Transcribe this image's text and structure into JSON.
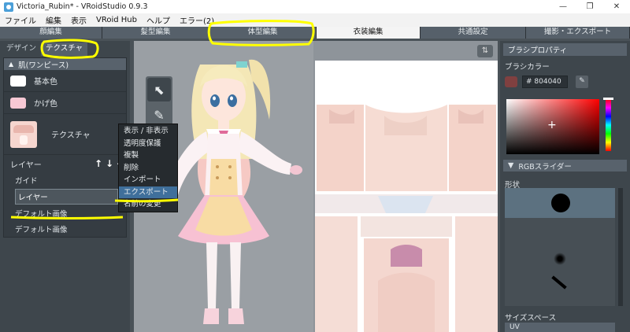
{
  "window": {
    "title": "Victoria_Rubin* - VRoidStudio 0.9.3",
    "minimize": "—",
    "maximize": "❐",
    "close": "✕"
  },
  "menubar": [
    "ファイル",
    "編集",
    "表示",
    "VRoid Hub",
    "ヘルプ",
    "エラー(2)"
  ],
  "tabs": [
    "顔編集",
    "髪型編集",
    "体型編集",
    "衣装編集",
    "共通設定",
    "撮影・エクスポート"
  ],
  "active_tab": "衣装編集",
  "left": {
    "subtabs": [
      "デザイン",
      "テクスチャ"
    ],
    "active_subtab": "テクスチャ",
    "section_title": "肌(ワンピース)",
    "section_arrow": "▲",
    "base_color_label": "基本色",
    "shadow_color_label": "かげ色",
    "texture_label": "テクスチャ",
    "layer_label": "レイヤー",
    "layer_up": "↑",
    "layer_down": "↓",
    "layer_add": "+",
    "layers": [
      "ガイド",
      "レイヤー",
      "デフォルト画像",
      "デフォルト画像"
    ]
  },
  "context_menu": [
    "表示 / 非表示",
    "透明度保護",
    "複製",
    "削除",
    "インポート",
    "エクスポート",
    "名前の変更"
  ],
  "context_highlight": "エクスポート",
  "tools": {
    "select_glyph": "⬉",
    "pen_glyph": "✎"
  },
  "view_btn_glyph": "⇅",
  "right": {
    "header": "ブラシプロパティ",
    "brush_color_label": "ブラシカラー",
    "hex": "# 804040",
    "picker_glyph": "✎",
    "sv_cursor": "+",
    "rgb_label": "RGBスライダー",
    "rgb_arrow": "▼",
    "shape_label": "形状",
    "size_space_label": "サイズスペース",
    "size_space_value": "UV"
  },
  "colors": {
    "base_color": "#ffffff",
    "shadow_color": "#f7c8d4",
    "brush_color": "#804040",
    "highlight": "#ffff00"
  },
  "icons": [
    "window-app-icon",
    "cursor-select-icon",
    "pen-icon",
    "color-picker-icon",
    "view-toggle-icon"
  ]
}
